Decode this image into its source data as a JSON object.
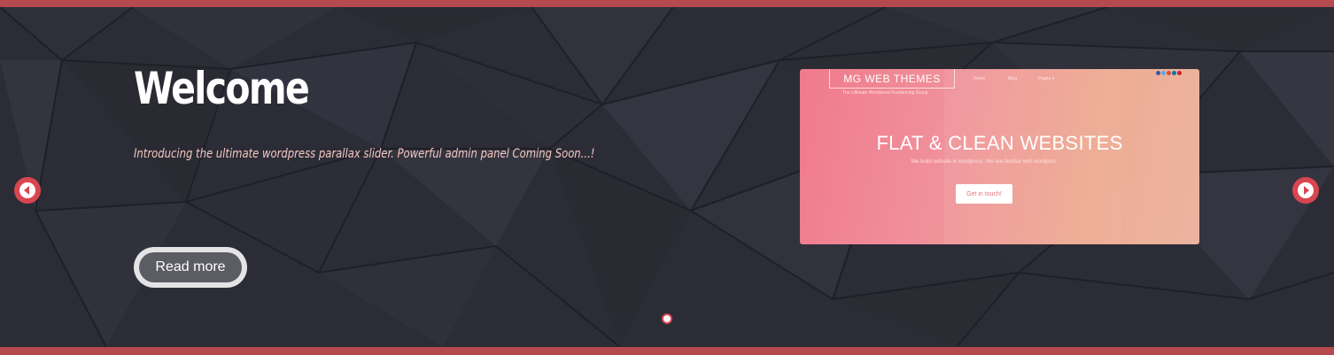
{
  "slide": {
    "title": "Welcome",
    "tagline": "Introducing the ultimate wordpress parallax slider. Powerful admin panel Coming  Soon...!",
    "read_more_label": "Read more"
  },
  "navigation": {
    "prev_icon": "chevron-left-icon",
    "next_icon": "chevron-right-icon",
    "active_dot_index": 0,
    "dot_count": 1
  },
  "preview": {
    "brand": "MG WEB THEMES",
    "brand_sub": "The Ultimate Wordpress Freelancing Group",
    "nav_items": [
      "Home",
      "Blog",
      "Pages ▾"
    ],
    "social_icons": [
      "twitter-icon",
      "facebook-icon",
      "google-plus-icon",
      "linkedin-icon",
      "pinterest-icon"
    ],
    "hero_title": "FLAT & CLEAN WEBSITES",
    "hero_subtitle": "We build website in wordpress. We are familiar with wordpres.",
    "cta_label": "Get in touch!"
  },
  "colors": {
    "accent": "#b44a4d",
    "arrow": "#d84650",
    "background": "#2c2c36",
    "tagline": "#f2c7c1"
  }
}
